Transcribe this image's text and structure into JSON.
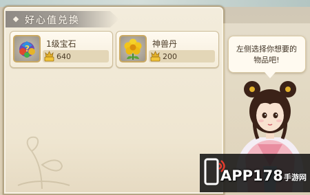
{
  "header": {
    "title": "好心值兑换"
  },
  "items": [
    {
      "name": "1级宝石",
      "price": "640",
      "icon": "gem-bag-icon"
    },
    {
      "name": "神兽丹",
      "price": "200",
      "icon": "yellow-flower-icon"
    }
  ],
  "currency_icon": "kindness-coin-icon",
  "npc": {
    "speech": "左侧选择你想要的物品吧!"
  },
  "watermark": {
    "text": "APP178",
    "suffix": "手游网"
  },
  "colors": {
    "panel": "#efe6d1",
    "border": "#b4a584",
    "text": "#4b3b26",
    "title_tab": "#8f8a84"
  }
}
